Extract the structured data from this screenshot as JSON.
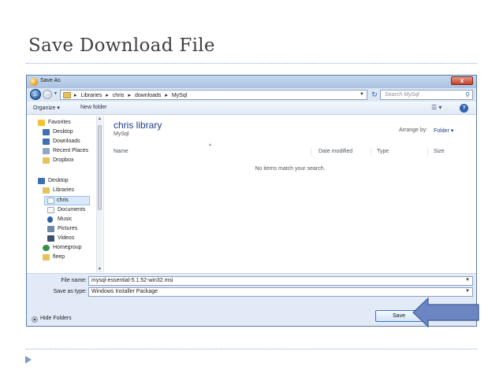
{
  "slide": {
    "title": "Save Download File"
  },
  "dialog": {
    "title": "Save As",
    "close_label": "x",
    "address": {
      "crumbs": [
        "▸",
        "Libraries",
        "▸",
        "chris",
        "▸",
        "downloads",
        "▸",
        "MySql"
      ]
    },
    "search_placeholder": "Search MySql",
    "toolbar": {
      "organize": "Organize ▾",
      "new_folder": "New folder"
    },
    "nav": [
      {
        "label": "Favorites",
        "icon": "star-icon"
      },
      {
        "label": "Desktop",
        "icon": "desktop-icon"
      },
      {
        "label": "Downloads",
        "icon": "downloads-icon"
      },
      {
        "label": "Recent Places",
        "icon": "recent-places-icon"
      },
      {
        "label": "Dropbox",
        "icon": "dropbox-icon"
      },
      {
        "label": "Desktop",
        "icon": "desktop-icon"
      },
      {
        "label": "Libraries",
        "icon": "libraries-icon"
      },
      {
        "label": "chris",
        "icon": "folder-icon"
      },
      {
        "label": "Documents",
        "icon": "documents-icon"
      },
      {
        "label": "Music",
        "icon": "music-icon"
      },
      {
        "label": "Pictures",
        "icon": "pictures-icon"
      },
      {
        "label": "Videos",
        "icon": "videos-icon"
      },
      {
        "label": "Homegroup",
        "icon": "homegroup-icon"
      },
      {
        "label": "fleep",
        "icon": "user-folder-icon"
      }
    ],
    "library_title": "chris library",
    "library_subtitle": "MySql",
    "arrange_by_label": "Arrange by:",
    "arrange_by_value": "Folder ▾",
    "columns": [
      "Name",
      "Date modified",
      "Type",
      "Size"
    ],
    "empty_message": "No items match your search.",
    "file_name_label": "File name:",
    "file_name_value": "mysql-essential-5.1.52-win32.msi",
    "save_as_type_label": "Save as type:",
    "save_as_type_value": "Windows Installer Package",
    "hide_folders": "Hide Folders",
    "save_button": "Save"
  },
  "colors": {
    "accent_arrow": "#6b86c2",
    "library_title": "#1e3b8a",
    "rule": "#8eaadb"
  }
}
